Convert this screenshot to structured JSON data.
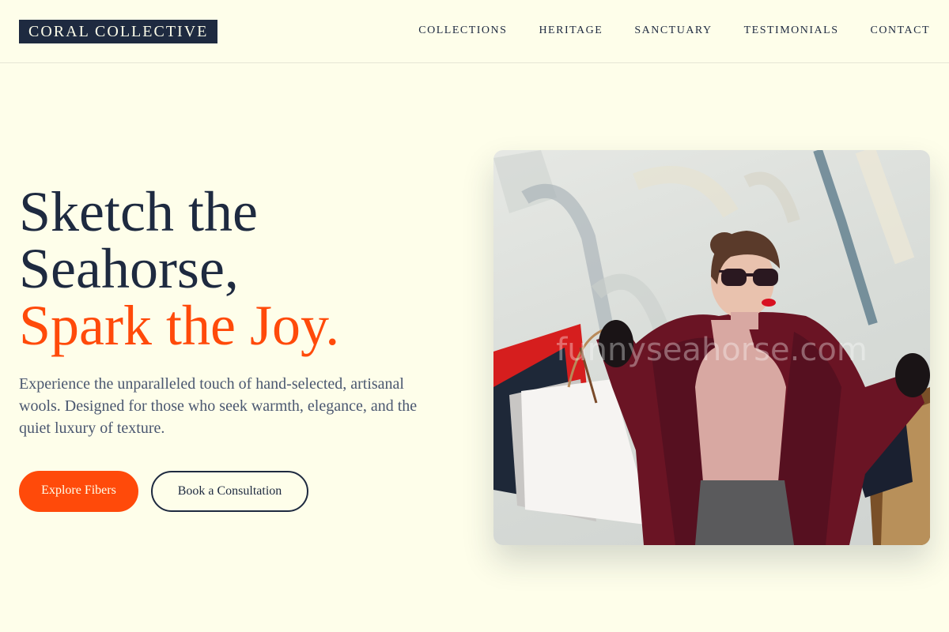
{
  "header": {
    "logo": "CORAL COLLECTIVE",
    "nav": [
      "COLLECTIONS",
      "HERITAGE",
      "SANCTUARY",
      "TESTIMONIALS",
      "CONTACT"
    ]
  },
  "hero": {
    "title_line1": "Sketch the",
    "title_line2": "Seahorse,",
    "title_line3": "Spark the Joy.",
    "description": "Experience the unparalleled touch of hand-selected, artisanal wools. Designed for those who seek warmth, elegance, and the quiet luxury of texture.",
    "primary_button": "Explore Fibers",
    "secondary_button": "Book a Consultation",
    "image_watermark": "funnyseahorse.com"
  },
  "colors": {
    "background": "#fefeea",
    "navy": "#1e2a40",
    "accent": "#ff4a0a",
    "body_text": "#4a5770"
  }
}
